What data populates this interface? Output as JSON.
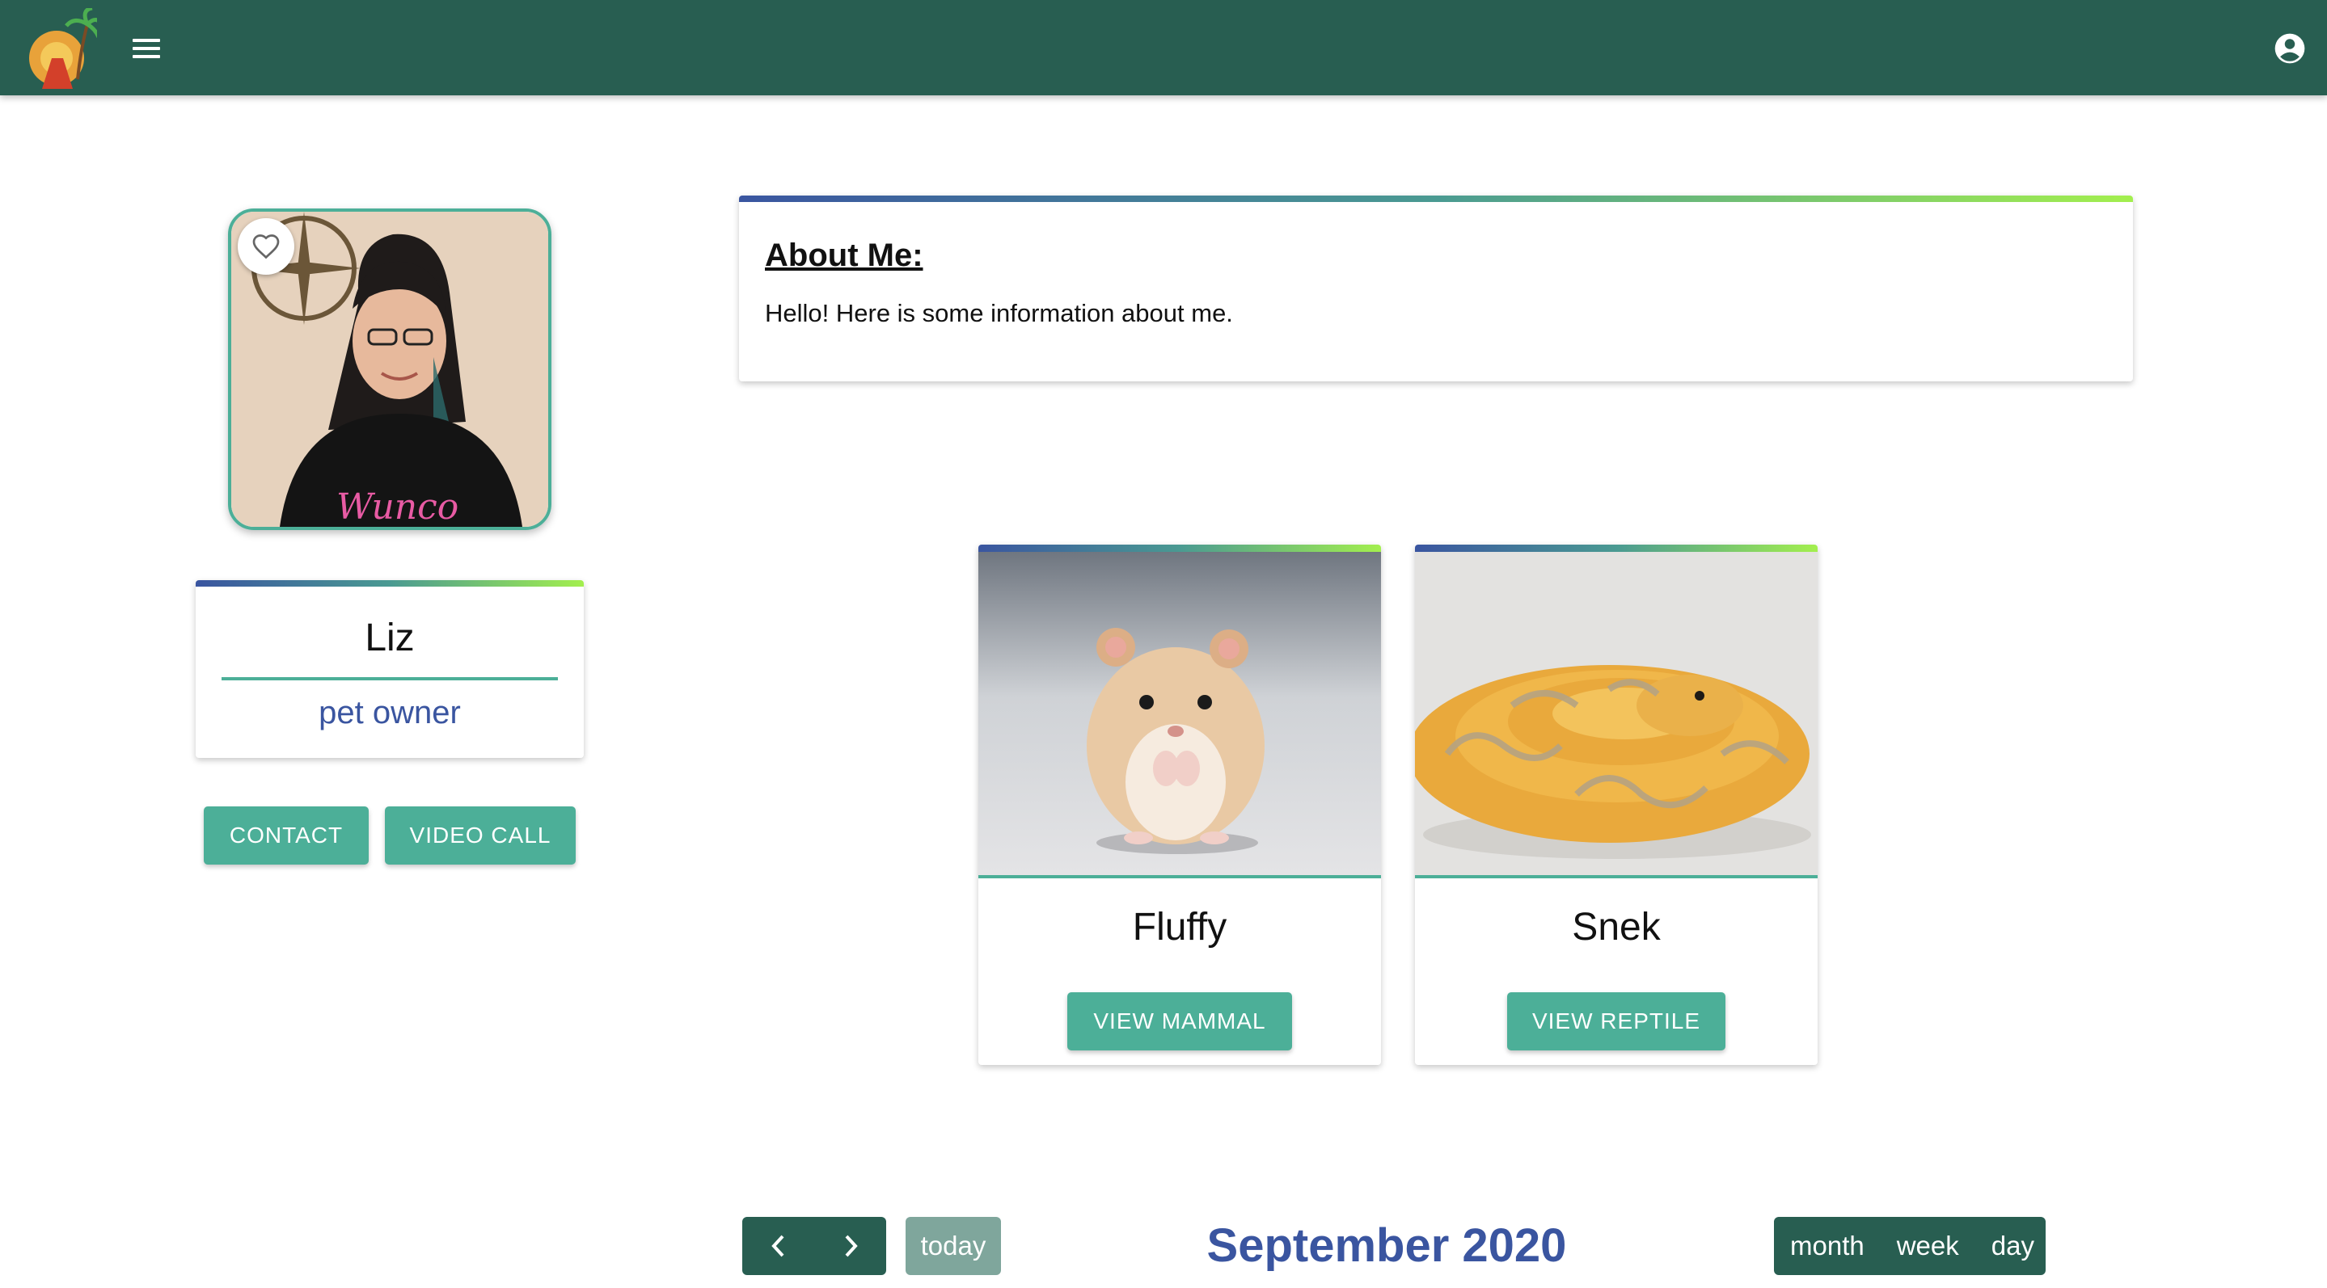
{
  "app": {
    "logo": "palm-tree-sunset-logo",
    "menu_icon": "hamburger-menu-icon",
    "account_icon": "account-circle-icon"
  },
  "profile": {
    "photo": "profile-photo",
    "favorite_icon": "heart-outline-icon",
    "name": "Liz",
    "role": "pet owner",
    "contact_label": "CONTACT",
    "video_call_label": "VIDEO CALL"
  },
  "about": {
    "title": "About Me:",
    "text": "Hello! Here is some information about me."
  },
  "pets": [
    {
      "name": "Fluffy",
      "button_label": "VIEW MAMMAL",
      "image": "hamster-photo"
    },
    {
      "name": "Snek",
      "button_label": "VIEW REPTILE",
      "image": "snake-photo"
    }
  ],
  "calendar": {
    "title": "September 2020",
    "today_label": "today",
    "prev_icon": "chevron-left-icon",
    "next_icon": "chevron-right-icon",
    "views": [
      "month",
      "week",
      "day"
    ]
  },
  "colors": {
    "appbar": "#285e51",
    "accent": "#4caf98",
    "brand_blue": "#3a55a0",
    "gradient_end": "#a3ef4e"
  }
}
